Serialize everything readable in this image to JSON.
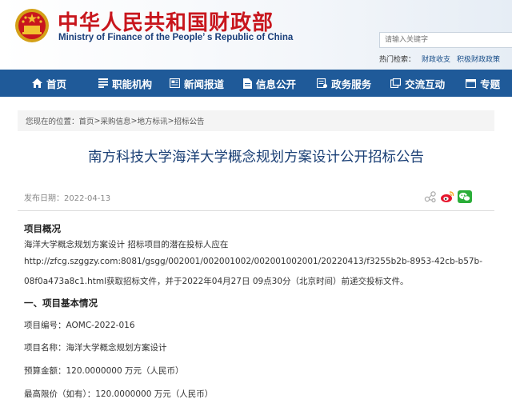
{
  "header": {
    "title_cn": "中华人民共和国财政部",
    "title_en": "Ministry of Finance of the People’ s Republic of China",
    "search_placeholder": "请输入关键字",
    "hotwords_label": "热门检索：",
    "hotwords": [
      "财政收支",
      "积极财政政策"
    ]
  },
  "nav": {
    "items": [
      {
        "label": "首页",
        "icon": "home-icon"
      },
      {
        "label": "职能机构",
        "icon": "org-icon"
      },
      {
        "label": "新闻报道",
        "icon": "news-icon"
      },
      {
        "label": "信息公开",
        "icon": "document-icon"
      },
      {
        "label": "政务服务",
        "icon": "service-icon"
      },
      {
        "label": "交流互动",
        "icon": "interaction-icon"
      },
      {
        "label": "专题",
        "icon": "topic-icon"
      }
    ]
  },
  "breadcrumb": {
    "prefix": "您现在的位置：",
    "items": [
      "首页",
      "采购信息",
      "地方标讯",
      "招标公告"
    ],
    "separator": ">"
  },
  "article": {
    "title": "南方科技大学海洋大学概念规划方案设计公开招标公告",
    "date_label": "发布日期：",
    "date": "2022-04-13",
    "share_icons": [
      "share-icon",
      "weibo-icon",
      "wechat-icon"
    ],
    "overview_heading": "项目概况",
    "overview_lines": [
      "海洋大学概念规划方案设计 招标项目的潜在投标人应在",
      "http://zfcg.szggzy.com:8081/gsgg/002001/002001002/002001002001/20220413/f3255b2b-8953-42cb-b57b-",
      "08f0a473a8c1.html获取招标文件，并于2022年04月27日 09点30分（北京时间）前递交投标文件。"
    ],
    "section1_heading": "一、项目基本情况",
    "fields": [
      {
        "label": "项目编号：",
        "value": "AOMC-2022-016"
      },
      {
        "label": "项目名称：",
        "value": "海洋大学概念规划方案设计"
      },
      {
        "label": "预算金额：",
        "value": "120.0000000 万元（人民币）"
      },
      {
        "label": "最高限价（如有）：",
        "value": "120.0000000 万元（人民币）"
      }
    ]
  },
  "colors": {
    "brand_red": "#c8161d",
    "nav_blue": "#1f5a99",
    "title_blue": "#1a3f75"
  }
}
